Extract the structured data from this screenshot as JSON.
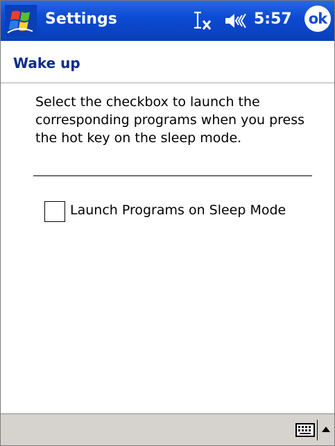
{
  "titlebar": {
    "app_title": "Settings",
    "clock": "5:57",
    "ok_label": "ok",
    "background_color": "#0c4bd4"
  },
  "icons": {
    "start": "windows-flag-icon",
    "input_status": "text-input-status-icon",
    "volume": "speaker-volume-icon",
    "keyboard": "keyboard-icon",
    "sip_arrow": "up-arrow-icon"
  },
  "page": {
    "title": "Wake up",
    "title_color": "#0b2c8a",
    "description": "Select the checkbox to launch the corresponding programs when you press the hot key on the sleep mode.",
    "checkbox_label": "Launch Programs on Sleep Mode",
    "checkbox_checked": false
  }
}
